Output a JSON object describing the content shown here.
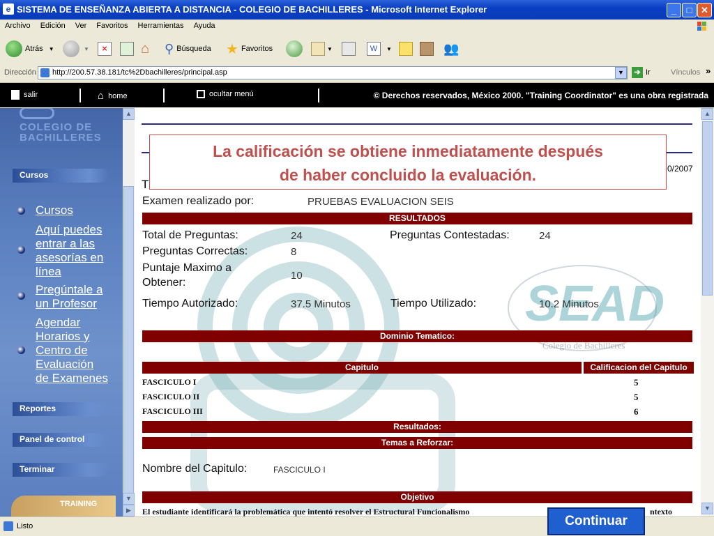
{
  "window": {
    "title": "SISTEMA DE ENSEÑANZA ABIERTA A DISTANCIA - COLEGIO DE BACHILLERES - Microsoft Internet Explorer",
    "minimize": "_",
    "maximize": "□",
    "close": "✕"
  },
  "menu": [
    "Archivo",
    "Edición",
    "Ver",
    "Favoritos",
    "Herramientas",
    "Ayuda"
  ],
  "toolbar": {
    "back": "Atrás",
    "search": "Búsqueda",
    "favorites": "Favoritos"
  },
  "address": {
    "label": "Dirección",
    "url": "http://200.57.38.181/tc%2Dbachilleres/principal.asp",
    "go": "Ir",
    "links": "Vínculos"
  },
  "header": {
    "exit": "salir",
    "home": "home",
    "hide_menu": "ocultar menú",
    "copyright": "© Derechos reservados, México 2000. \"Training Coordinator\" es una obra registrada"
  },
  "sidebar": {
    "logo_line1": "COLEGIO DE",
    "logo_line2": "BACHILLERES",
    "sections": {
      "cursos": "Cursos",
      "reportes": "Reportes",
      "panel": "Panel de control",
      "terminar": "Terminar",
      "training": "TRAINING"
    },
    "links": [
      [
        "Cursos"
      ],
      [
        "Aquí puedes",
        "entrar a las",
        "asesorías en",
        "línea"
      ],
      [
        "Pregúntale a",
        "un Profesor"
      ],
      [
        "Agendar",
        "Horarios y",
        "Centro de",
        "Evaluación",
        "de Examenes"
      ]
    ]
  },
  "content": {
    "date_fragment": "0/2007",
    "partial_t": "T",
    "exam_by_label": "Examen realizado por:",
    "exam_by_value": "PRUEBAS EVALUACION SEIS",
    "results_header": "RESULTADOS",
    "total_label": "Total de Preguntas:",
    "total_value": "24",
    "answered_label": "Preguntas Contestadas:",
    "answered_value": "24",
    "correct_label": "Preguntas Correctas:",
    "correct_value": "8",
    "max_label_1": "Puntaje Maximo a",
    "max_label_2": "Obtener:",
    "max_value": "10",
    "auth_time_label": "Tiempo Autorizado:",
    "auth_time_value": "37.5 Minutos",
    "used_time_label": "Tiempo Utilizado:",
    "used_time_value": "10.2 Minutos",
    "domain_header": "Dominio Tematico:",
    "chapter_header": "Capitulo",
    "grade_header": "Calificacion del Capitulo",
    "chapters": [
      {
        "name": "FASCICULO I",
        "grade": "5"
      },
      {
        "name": "FASCICULO II",
        "grade": "5"
      },
      {
        "name": "FASCICULO III",
        "grade": "6"
      }
    ],
    "results_sub": "Resultados:",
    "topics_header": "Temas a Reforzar:",
    "chapter_name_label": "Nombre del Capitulo:",
    "chapter_name_value": "FASCICULO I",
    "objective_header": "Objetivo",
    "objective_text": "El estudiante identificará la problemática que intentó resolver el Estructural Funcionalismo",
    "objective_text_end": "ntexto",
    "watermark_main": "SEAD",
    "watermark_sub": "Colegio de Bachilleres"
  },
  "callout": {
    "line1": "La calificación se obtiene inmediatamente después",
    "line2": "de haber concluido la evaluación."
  },
  "status": {
    "text": "Listo"
  },
  "continue_button": "Continuar"
}
